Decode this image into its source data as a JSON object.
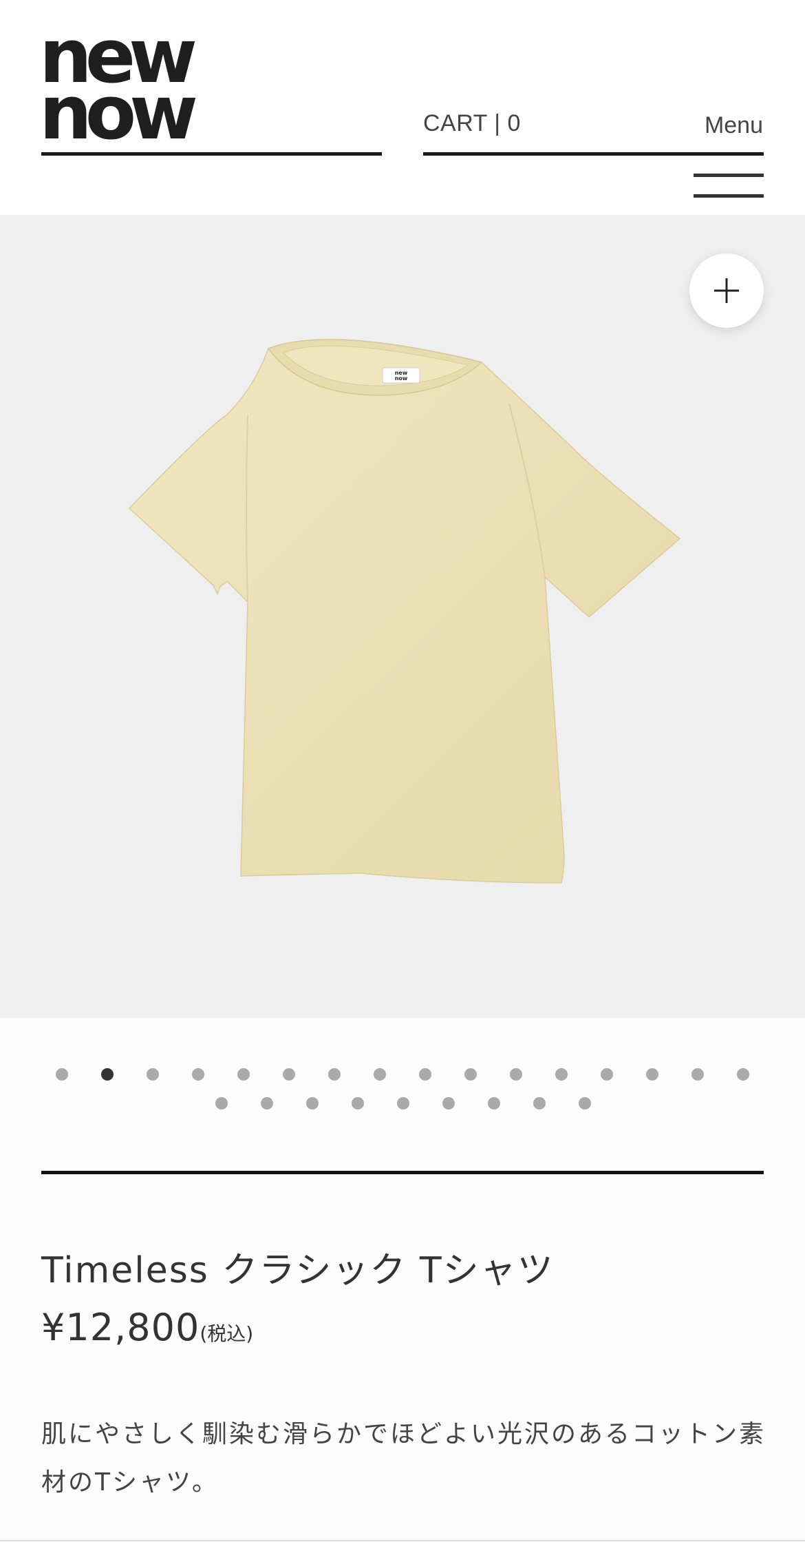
{
  "header": {
    "logo_top": "new",
    "logo_bottom": "now",
    "cart_label": "CART | 0",
    "menu_label": "Menu"
  },
  "gallery": {
    "total_images": 25,
    "active_index": 1,
    "shirt_tag_text_top": "new",
    "shirt_tag_text_bottom": "now",
    "shirt_color": "#EDE2B8",
    "background_color": "#EFEFEF"
  },
  "product": {
    "title": "Timeless クラシック Tシャツ",
    "price": "¥12,800",
    "tax_note": "(税込)",
    "description": "肌にやさしく馴染む滑らかでほどよい光沢のあるコットン素材のTシャツ。"
  }
}
